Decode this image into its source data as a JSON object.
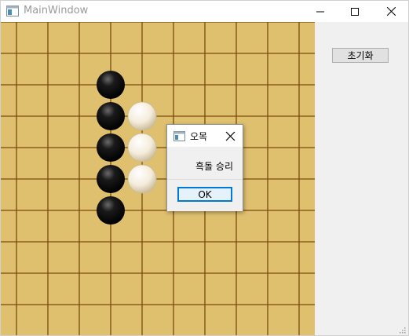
{
  "window": {
    "title": "MainWindow",
    "controls": [
      "minimize",
      "maximize",
      "close"
    ]
  },
  "side_panel": {
    "reset_label": "초기화"
  },
  "board": {
    "background_color": "#dfc06f",
    "line_color": "#7a4a0c",
    "stones": [
      {
        "color": "black",
        "col": 3,
        "row": 2
      },
      {
        "color": "black",
        "col": 3,
        "row": 3
      },
      {
        "color": "black",
        "col": 3,
        "row": 4
      },
      {
        "color": "black",
        "col": 3,
        "row": 5
      },
      {
        "color": "black",
        "col": 3,
        "row": 6
      },
      {
        "color": "white",
        "col": 4,
        "row": 3
      },
      {
        "color": "white",
        "col": 4,
        "row": 4
      },
      {
        "color": "white",
        "col": 4,
        "row": 5
      }
    ]
  },
  "dialog": {
    "title": "오목",
    "message": "흑돌 승리",
    "ok_label": "OK",
    "accent_color": "#0078d7"
  },
  "icons": {
    "app": "window-app-icon",
    "minimize": "minimize-icon",
    "maximize": "maximize-icon",
    "close": "close-icon",
    "dialog_close": "close-icon",
    "resize_grip": "resize-grip-icon"
  }
}
